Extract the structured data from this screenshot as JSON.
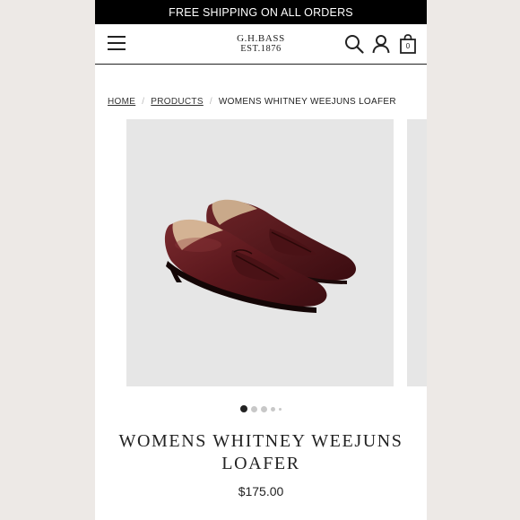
{
  "promo": {
    "text": "FREE SHIPPING ON ALL ORDERS"
  },
  "header": {
    "logo_line1": "G.H.BASS",
    "logo_line2": "EST.1876",
    "menu_icon": "hamburger-menu-icon",
    "search_icon": "search-icon",
    "account_icon": "account-icon",
    "bag_icon": "shopping-bag-icon",
    "bag_count": "0"
  },
  "breadcrumb": {
    "items": [
      {
        "label": "HOME"
      },
      {
        "label": "PRODUCTS"
      }
    ],
    "current": "WOMENS WHITNEY WEEJUNS LOAFER"
  },
  "gallery": {
    "slide_count": 5,
    "active_index": 0,
    "product_color": "#5e1a1f"
  },
  "product": {
    "title": "WOMENS WHITNEY WEEJUNS LOAFER",
    "price": "$175.00"
  }
}
